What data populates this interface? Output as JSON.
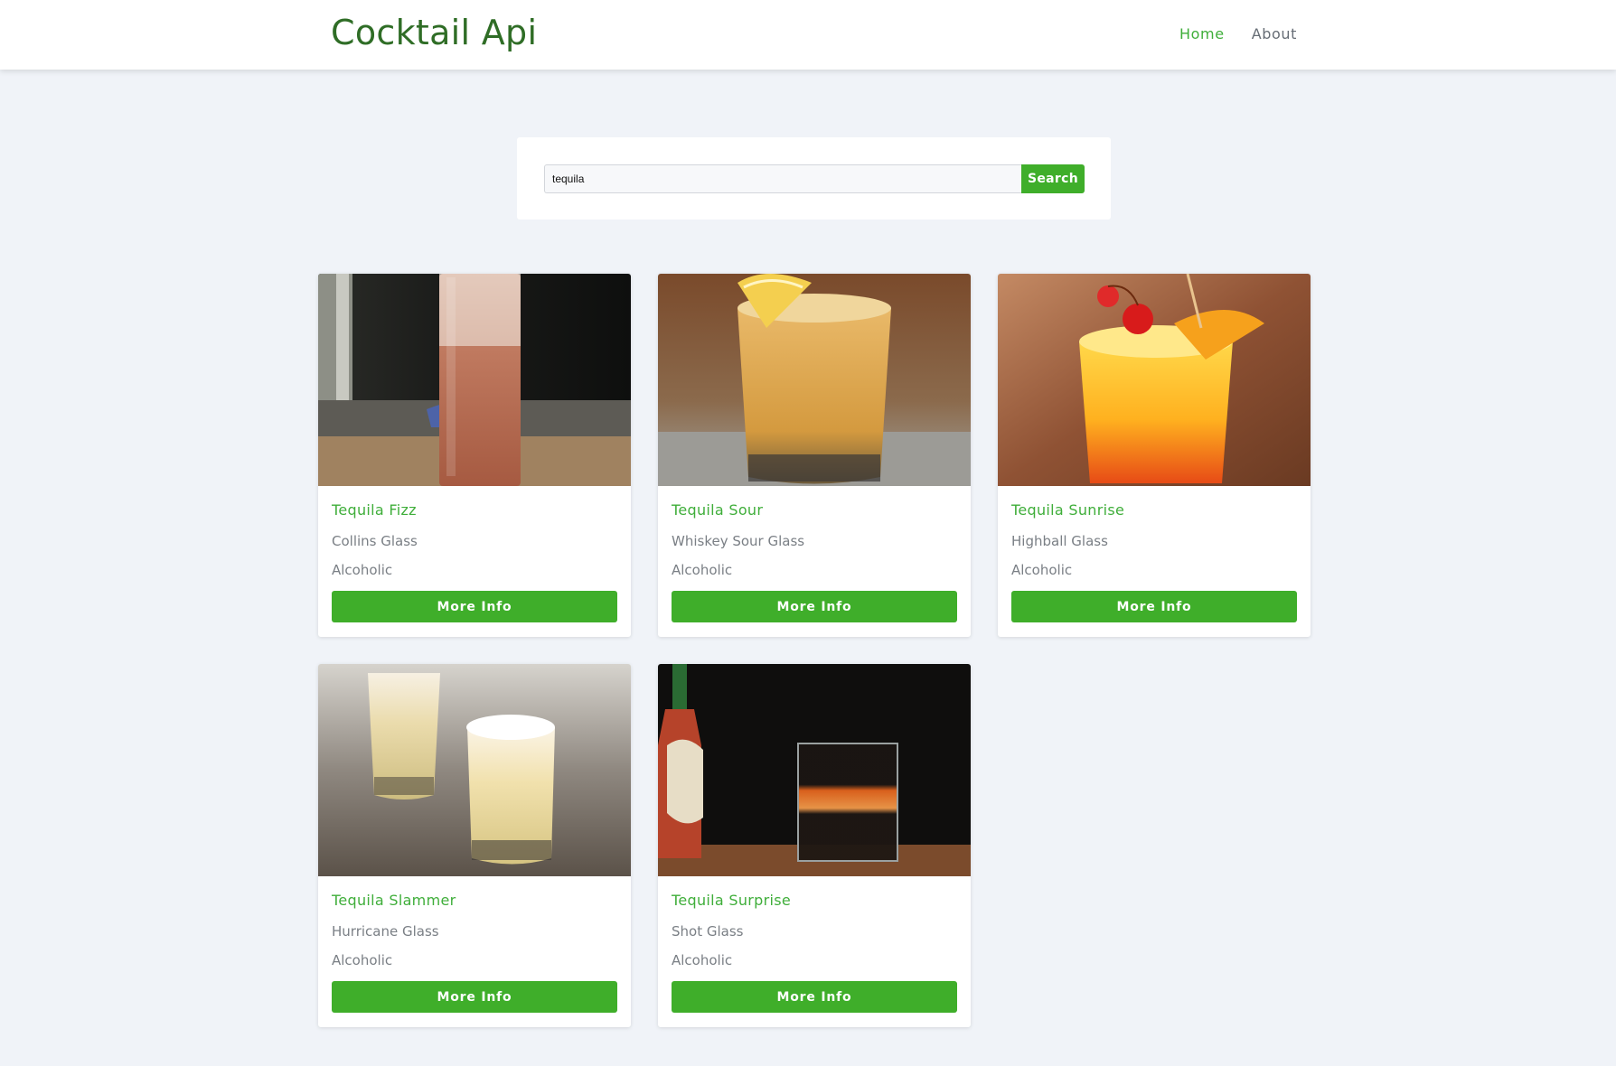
{
  "header": {
    "brand": "Cocktail Api",
    "nav": [
      {
        "label": "Home",
        "active": true
      },
      {
        "label": "About",
        "active": false
      }
    ]
  },
  "search": {
    "value": "tequila",
    "button_label": "Search"
  },
  "cards": [
    {
      "title": "Tequila Fizz",
      "glass": "Collins Glass",
      "type": "Alcoholic",
      "button_label": "More Info"
    },
    {
      "title": "Tequila Sour",
      "glass": "Whiskey Sour Glass",
      "type": "Alcoholic",
      "button_label": "More Info"
    },
    {
      "title": "Tequila Sunrise",
      "glass": "Highball Glass",
      "type": "Alcoholic",
      "button_label": "More Info"
    },
    {
      "title": "Tequila Slammer",
      "glass": "Hurricane Glass",
      "type": "Alcoholic",
      "button_label": "More Info"
    },
    {
      "title": "Tequila Surprise",
      "glass": "Shot Glass",
      "type": "Alcoholic",
      "button_label": "More Info"
    }
  ],
  "colors": {
    "accent": "#3fae2a",
    "brand": "#2f6d26",
    "background": "#f0f3f8"
  }
}
